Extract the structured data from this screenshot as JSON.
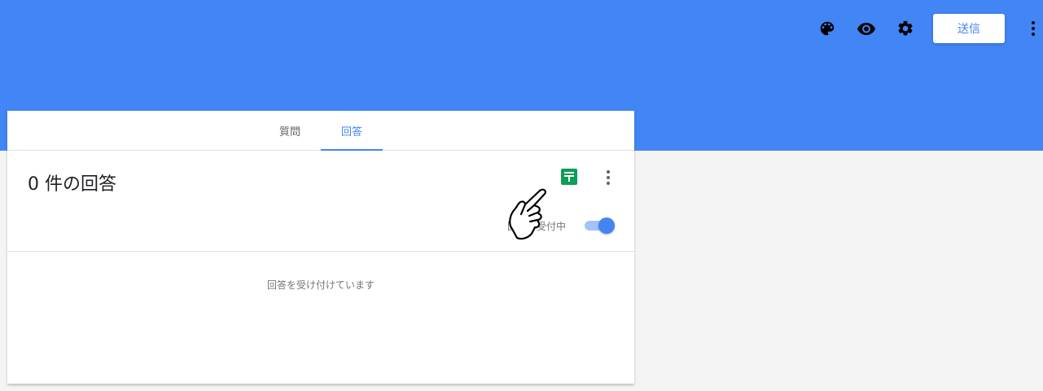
{
  "header": {
    "send_label": "送信",
    "icons": [
      "palette-icon",
      "eye-icon",
      "gear-icon",
      "more-vert-icon"
    ],
    "background_color": "#4285f4"
  },
  "tabs": [
    {
      "label": "質問",
      "active": false
    },
    {
      "label": "回答",
      "active": true
    }
  ],
  "responses": {
    "count_title": "0 件の回答",
    "sheets_icon_color": "#0f9d58",
    "accepting_label": "回答を受付中",
    "accepting_toggle": true,
    "accepting_message": "回答を受け付けています"
  }
}
